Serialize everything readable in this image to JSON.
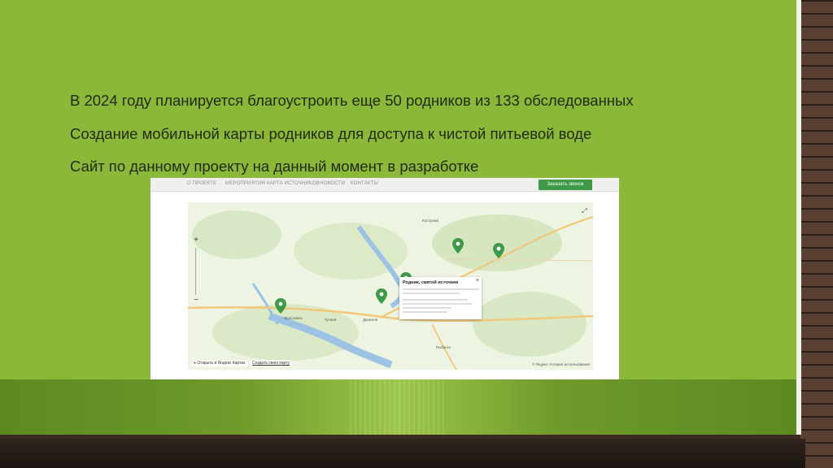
{
  "bullets": [
    "В 2024 году планируется благоустроить еще 50 родников из 133 обследованных",
    "Создание мобильной карты родников для доступа к чистой питьевой воде",
    "Сайт по данному проекту на данный момент в разработке"
  ],
  "site": {
    "nav": [
      "О ПРОЕКТЕ",
      "МЕРОПРИЯТИЯ",
      "КАРТА ИСТОЧНИКОВ",
      "НОВОСТИ",
      "КОНТАКТЫ"
    ],
    "call_button": "Заказать звонок"
  },
  "map": {
    "open_in_yandex": "Открыть в Яндекс Картах",
    "create_map": "Создать свою карту",
    "attribution": "© Яндекс Условия использования",
    "popup_title": "Родник, святой источник",
    "cities": [
      "Ярославль",
      "Кострома",
      "Данилов",
      "Тутаев",
      "Рыбинск"
    ]
  },
  "colors": {
    "slide_green": "#8cb83a",
    "marker_green": "#3e9a46"
  }
}
